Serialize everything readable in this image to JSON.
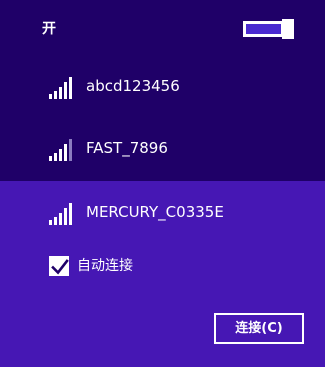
{
  "header": {
    "title": "开",
    "toggle_state": "on"
  },
  "networks": [
    {
      "name": "abcd123456",
      "signal_bars": 5,
      "signal_icon": "wifi-signal-icon"
    },
    {
      "name": "FAST_7896",
      "signal_bars": 4,
      "signal_icon": "wifi-signal-icon"
    },
    {
      "name": "MERCURY_C0335E",
      "signal_bars": 5,
      "signal_icon": "wifi-signal-icon",
      "selected": true
    }
  ],
  "selected_network": {
    "auto_connect_label": "自动连接",
    "auto_connect_checked": true,
    "connect_label": "连接(C)"
  },
  "colors": {
    "panel_bg": "#1f0068",
    "selected_bg": "#4617b4",
    "toggle_fill": "#4a2ad0",
    "text": "#ffffff"
  }
}
